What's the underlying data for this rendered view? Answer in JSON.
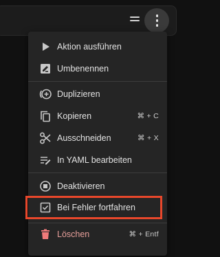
{
  "menu": {
    "items": [
      {
        "label": "Aktion ausführen",
        "icon": "play-icon"
      },
      {
        "label": "Umbenennen",
        "icon": "rename-icon"
      },
      {
        "label": "Duplizieren",
        "icon": "duplicate-icon"
      },
      {
        "label": "Kopieren",
        "icon": "copy-icon",
        "shortcut": "⌘ + C"
      },
      {
        "label": "Ausschneiden",
        "icon": "scissors-icon",
        "shortcut": "⌘ + X"
      },
      {
        "label": "In YAML bearbeiten",
        "icon": "edit-yaml-icon"
      },
      {
        "label": "Deaktivieren",
        "icon": "stop-circle-icon"
      },
      {
        "label": "Bei Fehler fortfahren",
        "icon": "checkbox-checked-icon"
      },
      {
        "label": "Löschen",
        "icon": "trash-icon",
        "shortcut": "⌘ + Entf"
      }
    ]
  },
  "colors": {
    "background": "#111111",
    "menu_bg": "#252525",
    "text": "#e3e3e3",
    "danger_text": "#e8a09b",
    "danger_icon": "#f07a7a",
    "highlight": "#e8472b"
  }
}
